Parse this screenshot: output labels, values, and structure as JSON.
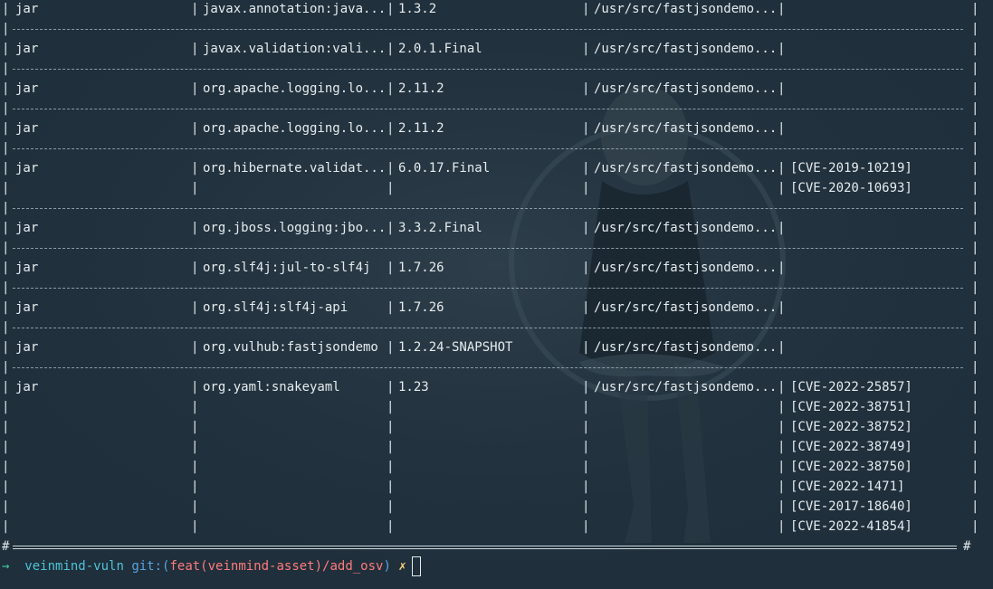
{
  "rows": [
    {
      "type": "jar",
      "name": "javax.annotation:java...",
      "version": "1.3.2",
      "path": "/usr/src/fastjsondemo...",
      "cves": []
    },
    {
      "type": "jar",
      "name": "javax.validation:vali...",
      "version": "2.0.1.Final",
      "path": "/usr/src/fastjsondemo...",
      "cves": []
    },
    {
      "type": "jar",
      "name": "org.apache.logging.lo...",
      "version": "2.11.2",
      "path": "/usr/src/fastjsondemo...",
      "cves": []
    },
    {
      "type": "jar",
      "name": "org.apache.logging.lo...",
      "version": "2.11.2",
      "path": "/usr/src/fastjsondemo...",
      "cves": []
    },
    {
      "type": "jar",
      "name": "org.hibernate.validat...",
      "version": "6.0.17.Final",
      "path": "/usr/src/fastjsondemo...",
      "cves": [
        "[CVE-2019-10219]",
        "[CVE-2020-10693]"
      ]
    },
    {
      "type": "jar",
      "name": "org.jboss.logging:jbo...",
      "version": "3.3.2.Final",
      "path": "/usr/src/fastjsondemo...",
      "cves": []
    },
    {
      "type": "jar",
      "name": "org.slf4j:jul-to-slf4j",
      "version": "1.7.26",
      "path": "/usr/src/fastjsondemo...",
      "cves": []
    },
    {
      "type": "jar",
      "name": "org.slf4j:slf4j-api",
      "version": "1.7.26",
      "path": "/usr/src/fastjsondemo...",
      "cves": []
    },
    {
      "type": "jar",
      "name": "org.vulhub:fastjsondemo",
      "version": "1.2.24-SNAPSHOT",
      "path": "/usr/src/fastjsondemo...",
      "cves": []
    },
    {
      "type": "jar",
      "name": "org.yaml:snakeyaml",
      "version": "1.23",
      "path": "/usr/src/fastjsondemo...",
      "cves": [
        "[CVE-2022-25857]",
        "[CVE-2022-38751]",
        "[CVE-2022-38752]",
        "[CVE-2022-38749]",
        "[CVE-2022-38750]",
        "[CVE-2022-1471]",
        "[CVE-2017-18640]",
        "[CVE-2022-41854]"
      ]
    }
  ],
  "footer_hash": "#",
  "prompt": {
    "arrow": "→",
    "dir": "veinmind-vuln",
    "git_label": "git:(",
    "branch": "feat(veinmind-asset)/add_osv",
    "git_close": ")",
    "dirty": "✗"
  },
  "colors": {
    "background": "#1f2f3b",
    "text": "#e6ecef",
    "prompt_arrow": "#3fd0a0",
    "prompt_dir": "#4ec3d8",
    "prompt_git": "#5aa3e0",
    "prompt_branch": "#ff7b7b",
    "prompt_dirty": "#ffd27a"
  }
}
